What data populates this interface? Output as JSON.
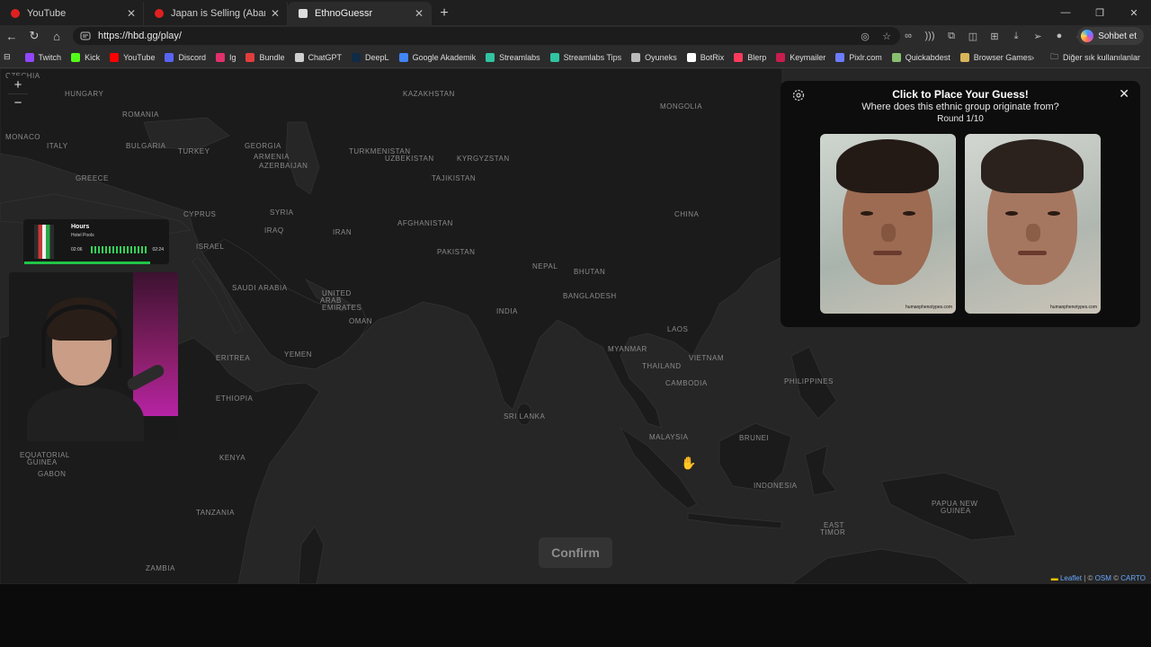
{
  "tabs": [
    {
      "label": "YouTube",
      "active": false
    },
    {
      "label": "Japan is Selling (Abandoned) Hou",
      "active": false
    },
    {
      "label": "EthnoGuessr",
      "active": true
    }
  ],
  "address": {
    "url": "https://hbd.gg/play/"
  },
  "chat_button": {
    "label": "Sohbet et"
  },
  "bookmarks": [
    {
      "label": "Twitch",
      "color": "#9146ff"
    },
    {
      "label": "Kick",
      "color": "#53fc18"
    },
    {
      "label": "YouTube",
      "color": "#ff0000"
    },
    {
      "label": "Discord",
      "color": "#5865f2"
    },
    {
      "label": "Ig",
      "color": "#e1306c"
    },
    {
      "label": "Bundle",
      "color": "#e23d3d"
    },
    {
      "label": "ChatGPT",
      "color": "#cfcfcf"
    },
    {
      "label": "DeepL",
      "color": "#0f2b46"
    },
    {
      "label": "Google Akademik",
      "color": "#4285f4"
    },
    {
      "label": "Streamlabs",
      "color": "#31c3a2"
    },
    {
      "label": "Streamlabs Tips",
      "color": "#31c3a2"
    },
    {
      "label": "Oyuneks",
      "color": "#bbbbbb"
    },
    {
      "label": "BotRix",
      "color": "#ffffff"
    },
    {
      "label": "Blerp",
      "color": "#ff3b5c"
    },
    {
      "label": "Keymailer",
      "color": "#c81d4e"
    },
    {
      "label": "Pixlr.com",
      "color": "#6c7cff"
    },
    {
      "label": "Quickabdest",
      "color": "#88c070"
    },
    {
      "label": "Browser Games",
      "color": "#d8b45a"
    }
  ],
  "bookmarks_more": {
    "label": "Diğer sık kullanılanlar"
  },
  "map": {
    "labels": [
      {
        "text": "CZECHIA"
      },
      {
        "text": "HUNGARY"
      },
      {
        "text": "ROMANIA"
      },
      {
        "text": "MONACO"
      },
      {
        "text": "ITALY"
      },
      {
        "text": "BULGARIA"
      },
      {
        "text": "GREECE"
      },
      {
        "text": "TURKEY"
      },
      {
        "text": "GEORGIA"
      },
      {
        "text": "ARMENIA"
      },
      {
        "text": "AZERBAIJAN"
      },
      {
        "text": "KAZAKHSTAN"
      },
      {
        "text": "MONGOLIA"
      },
      {
        "text": "UZBEKISTAN"
      },
      {
        "text": "KYRGYZSTAN"
      },
      {
        "text": "TURKMENISTAN"
      },
      {
        "text": "TAJIKISTAN"
      },
      {
        "text": "CYPRUS"
      },
      {
        "text": "SYRIA"
      },
      {
        "text": "IRAQ"
      },
      {
        "text": "IRAN"
      },
      {
        "text": "AFGHANISTAN"
      },
      {
        "text": "CHINA"
      },
      {
        "text": "ISRAEL"
      },
      {
        "text": "PAKISTAN"
      },
      {
        "text": "NEPAL"
      },
      {
        "text": "BHUTAN"
      },
      {
        "text": "SAUDI ARABIA"
      },
      {
        "text": "UNITED"
      },
      {
        "text": "ARAB"
      },
      {
        "text": "EMIRATES"
      },
      {
        "text": "BANGLADESH"
      },
      {
        "text": "INDIA"
      },
      {
        "text": "OMAN"
      },
      {
        "text": "LAOS"
      },
      {
        "text": "MYANMAR"
      },
      {
        "text": "YEMEN"
      },
      {
        "text": "ERITREA"
      },
      {
        "text": "THAILAND"
      },
      {
        "text": "VIETNAM"
      },
      {
        "text": "CAMBODIA"
      },
      {
        "text": "PHILIPPINES"
      },
      {
        "text": "ETHIOPIA"
      },
      {
        "text": "SRI LANKA"
      },
      {
        "text": "MALAYSIA"
      },
      {
        "text": "BRUNEI"
      },
      {
        "text": "EQUATORIAL"
      },
      {
        "text": "GUINEA"
      },
      {
        "text": "GABON"
      },
      {
        "text": "KENYA"
      },
      {
        "text": "INDONESIA"
      },
      {
        "text": "TANZANIA"
      },
      {
        "text": "PAPUA NEW"
      },
      {
        "text": "GUINEA"
      },
      {
        "text": "EAST"
      },
      {
        "text": "TIMOR"
      },
      {
        "text": "ZAMBIA"
      }
    ],
    "confirm_label": "Confirm",
    "attribution": {
      "leaflet": "Leaflet",
      "sep": "|",
      "copy": "©",
      "osm": "OSM",
      "carto": "CARTO"
    }
  },
  "panel": {
    "title": "Click to Place Your Guess!",
    "subtitle": "Where does this ethnic group originate from?",
    "round": "Round 1/10",
    "watermark": "humanphenotypes.com"
  },
  "music": {
    "title": "Hours",
    "artist": "Hotel Pools",
    "elapsed": "02:06",
    "total": "02:24"
  },
  "colors": {
    "map_bg": "#262626",
    "land": "#1b1b1b",
    "accent_green": "#22c448",
    "panel_bg": "#0d0d0d"
  }
}
